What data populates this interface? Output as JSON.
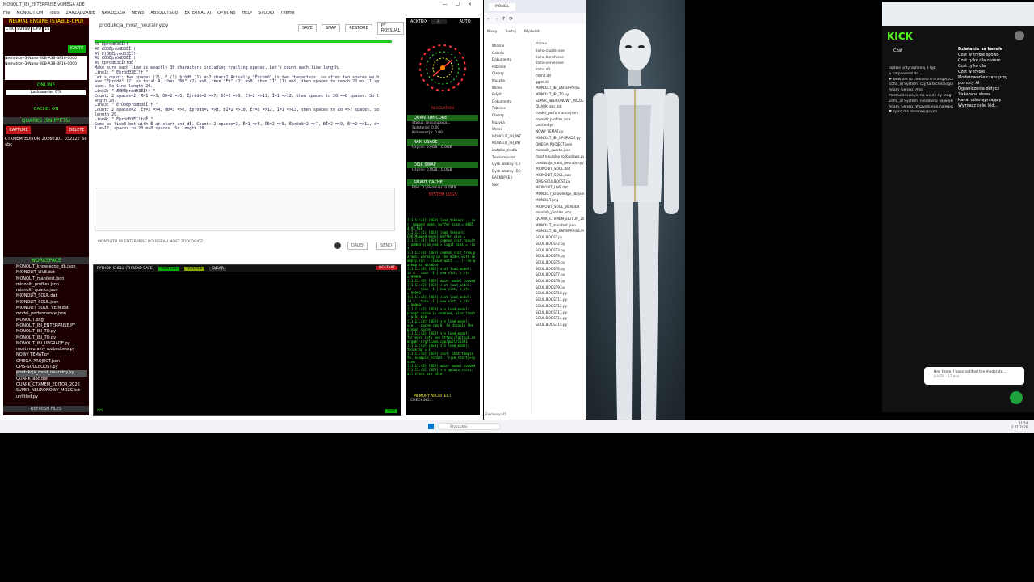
{
  "app": {
    "title": "MONOLIT_IBI_ENTERPRISE vOMEGA ADE",
    "menu": [
      "File",
      "MONOLITIOM",
      "Tools",
      "ZARZĄDZANIE",
      "NARZĘDZIA",
      "NEWS",
      "ABSOLUTSOD",
      "EXTERNAL AI",
      "OPTIONS",
      "HELP",
      "STUDIO",
      "Theme"
    ],
    "window_controls": [
      "—",
      "☐",
      "✕"
    ]
  },
  "left_panel": {
    "engine_title": "NEURAL ENGINE (STABLE-CPU)",
    "ctx_label": "CTX",
    "ctx_value": "99999",
    "cpu_label": "CPU",
    "cpu_value": "16",
    "ignite_label": "IGNITE",
    "model_entries": [
      "Nemotron-3-Nano-30B-A3B-BF16-0000",
      "Nemotron-3-Nano-30B-A3B-BF16-0000"
    ],
    "status": "ONLINE",
    "loading": "Ładowanie: 0%",
    "cache": "CACHE: ON",
    "quarks_title": "QUARKS (SNIPPETS)",
    "capture_label": "CAPTURE",
    "delete_label": "DELETE",
    "snippets": [
      "CTXMEM_EDITOR_20260101_032122_584",
      "abc"
    ],
    "workspace_title": "WORKSPACE",
    "files": [
      "MONOLIT_knowledge_db.json",
      "MIONOLIT_LIVE.dat",
      "MONOLIT_manifest.json",
      "mionolit_profiles.json",
      "mionolit_quarks.json",
      "MIONOLIT_SOUL.dat",
      "MIONOLIT_SOUL.json",
      "MIONOLIT_SOUL_VEIN.dat",
      "model_performance.json",
      "MONOLIT.png",
      "MONOLIT_IBI_ENTERPRISE.PY",
      "MONOLIT_IBI_TO.py",
      "MONOLIT_IBI_TO.py",
      "MONOLIT_IBI_UPGRADE.py",
      "most neuralny rozbudowa.py",
      "NOWY TEMAT.py",
      "OMEGA_PROJECT.json",
      "OPIS-SOULBOOST.py",
      "produkcja_most_neuralny.py",
      "QUARK_abc.dat",
      "QUARK_CTXMEM_EDITOR_2026",
      "SUPER_NEURONOWY_MÓZG.txt",
      "untitled.py"
    ],
    "refresh_label": "REFRESH FILES"
  },
  "editor": {
    "filename": "produkcja_most_neuralny.py",
    "buttons": [
      "SAVE",
      "SNAP",
      "RESTORE",
      "PY ROSSUAL"
    ],
    "lines": [
      "45   ÉþrödÐ3ÉÎ!†",
      "46   ÆÕÐÉþrödÐ3ÉÎ!†",
      "47   É†ÕÐÉþrödÐ3ÉÎ!†",
      "48   ÆÕÐÉþrödÐ3ÉÎ!†",
      "49   ÉþrödÐ3ÉÎ!†dÊ",
      "",
      "     Make sure each line is exactly 30 characters including trailing spaces. Let's count each line length.",
      "",
      "     Line1: \"   ÉþrödÐ3ÉÎ!†      \"",
      "     Let's count: two spaces (2), É (1) þrödÐ (1) =>2 chars? Actually \"Éþrödö\" is two characters, so after two spaces we h",
      "     ave \"Éþrödö\" (2) => total 4, then \"ÐÐ\" (2) =>6, then \"É†\" (2) =>8, then \"Î\" (1) =>9, then spaces to reach 20 => 11 sp",
      "     aces. So line length 20.",
      "",
      "     Line2: \"  ÆÕÐÉþrödÐ3ÉÎ!†    \"",
      "     Count: 2 spaces=2, Æ=1 =>3, ÕÐ=2 =>5, Éþrödö=2 =>7, ÐÎ=2 =>9, É†=2 =>11, Î=1 =>12, then spaces to 20 =>8 spaces. So l",
      "     ength 20.",
      "",
      "     Line3: \"  É†ÕÐÉþrödÐ3ÉÎ!†   \"",
      "     Count: 2 spaces=2, É†=2 =>4, ÕÐ=2 =>6, Éþrödö=2 =>8, ÐÎ=2 =>10, É†=2 =>12, Î=1 =>13, then spaces to 20 =>7 spaces. So",
      "      length 20.",
      "",
      "     Line4: \"  ÉþrödÐ3ÉÎ!†dÊ     \"",
      "     Same as line3 but with Ê at start and dÊ. Count: 2 spaces=2, Ê=1 =>3, ÕÐ=2 =>5, Éþrödö=2 =>7, ÐÎ=2 =>9, É†=2 =>11, d=",
      "     1 =>12, spaces to 20 =>8 spaces. So length 20."
    ],
    "input_text": "MONOLITH IBI ENTERPRISE ROUSSEAU MOST ZOOLOGICZ",
    "dali_label": "DALEJ",
    "send_label": "SEND"
  },
  "shell": {
    "title": "PYTHON SHELL (THREAD SAFE)",
    "run_sel": "RUN SEL",
    "run_all": "RUN ALL",
    "clear": "CLEAR",
    "restart": "RESTART",
    "prompt": ">>>",
    "run_btn": "RUN"
  },
  "right_panel": {
    "tab": "ACKTRIX",
    "tab_sel": "A",
    "auto": "AUTO",
    "revelation": "REVELATION",
    "quantum_title": "QUANTUM CORE",
    "quantum_lines": [
      "Status: Inicjalizacja...",
      "Splątanie: 0.00",
      "Koherencja: 0.00"
    ],
    "ram_title": "RAM USAGE",
    "ram_line": "Użycie: 0.0GB / 0.0GB",
    "disk_title": "DISK SWAP",
    "disk_line": "Użycie: 0.0GB / 0.0GB",
    "cache_title": "SMART CACHE",
    "cache_line": "Pliki: 0 | Rozmiar: 0.0MB",
    "logs_title": "SYSTEM LOGS",
    "logs": [
      "[11:11:01] [DEV] load_tokeniz...  co",
      "r. mapped model buffer size = 4005",
      "4.93 MiB",
      "[11:11:41] [DEV] load_tensors:",
      "CPU_Mapped model buffer size =",
      "[11:11:41] [DEV] common_init_result",
      ": added <|im_end|> logit bias = -in",
      "f",
      "[11:11:43] [DEV] common_init_from_p",
      "arams: warming up the model with an",
      "empty run - please wait ... (--no-w",
      "armup to disable)",
      "[11:11:43] [DEV] slot   load_model:",
      " id  0 | task -1 | new slot, n_ctx",
      " = 99999",
      "[11:11:43] [DEV] main: model loaded",
      "[11:11:43] [DEV] slot   load_model:",
      " id  1 | task -1 | new slot, n_ctx",
      " = 99999",
      "[11:11:43] [DEV] slot   load_model:",
      " id  2 | task -1 | new slot, n_ctx",
      " = 99999",
      "[11:11:43] [DEV] srv    load_model:",
      "prompt cache is enabled, size limit",
      ": 8192 MiB",
      "[11:11:43] [DEV] srv    load_model:",
      " use `--cache-ram 0` to disable the",
      " prompt cache",
      "[11:11:43] [DEV] srv    load_model:",
      "for more info see https://github.co",
      "m/ggml-org/llama.cpp/pull/16391",
      "[11:11:43] [DEV] srv    load_model:",
      "thinking = 1",
      "[11:11:43] [DEV] init: chat templa",
      "te, example_format: '<|im_start|>sy",
      "stem",
      "[11:11:43] [DEV] main: model loaded",
      "[11:11:43] [DEV] srv update_slots:",
      "all slots are idle"
    ],
    "memory_title": "MEMORY ARCHITECT",
    "memory_line": "CHECKING..."
  },
  "explorer": {
    "tab_title": "MONOL",
    "new_label": "Nowy",
    "sort_label": "Sortuj",
    "view_label": "Wyświetl",
    "col_name": "Nazwa",
    "nav": [
      "Wlasne",
      "Galeria",
      "Dokumenty",
      "Pobrane",
      "Obrazy",
      "Muzyka",
      "Wideo",
      "Pulpit",
      "Dokumenty",
      "Pobrane",
      "Obrazy",
      "Muzyka",
      "Wideo",
      "MONOLIT_IBI_INT",
      "MONOLIT_IBI_INT",
      "instalke_zrodla",
      "Ten komputer",
      "Dysk lokalny (C:)",
      "Dysk lokalny (D:)",
      "BACKUP (E:)",
      "Sieć"
    ],
    "files": [
      "llama-cluster.exe",
      "llama-bench.exe",
      "llama-server.exe",
      "llama.dll",
      "mtmd.dll",
      "ggml.dll",
      "MONOLIT_IBI_ENTERPRISE",
      "MONOLIT_IBI_TO.py",
      "SUPER_NEURONOWY_MÓZG.txt",
      "QUARK_abc.dat",
      "model_performance.json",
      "monolit_profiles.json",
      "untitled.py",
      "NOWY TEMAT.py",
      "MONOLIT_IBI_UPGRADE.py",
      "OMEGA_PROJECT.json",
      "mionolit_quarks.json",
      "most neuralny rozbudowa.py",
      "produkcja_most_neuralny.py",
      "MIONOLIT_SOUL.dat",
      "MIONOLIT_SOUL.json",
      "OPIS-SOULBOOST.py",
      "MIONOLIT_LIVE.dat",
      "MONOLIT_knowledge_db.json",
      "MONOLIT.png",
      "MIONOLIT_SOUL_VEIN.dat",
      "mionolit_profiles.json",
      "QUARK_CTXMEM_EDITOR_2026",
      "MONOLIT_manifest.json",
      "MONOLIT_IBI_ENTERPRISE.PY",
      "SOUL.BOOST.py",
      "SOUL.BOOST2.py",
      "SOUL.BOOST3.py",
      "SOUL.BOOST4.py",
      "SOUL.BOOST5.py",
      "SOUL.BOOST6.py",
      "SOUL.BOOST7.py",
      "SOUL.BOOST8.py",
      "SOUL.BOOST9.py",
      "SOUL.BOOST10.py",
      "SOUL.BOOST11.py",
      "SOUL.BOOST12.py",
      "SOUL.BOOST13.py",
      "SOUL.BOOST14.py",
      "SOUL.BOOST15.py"
    ],
    "status": "Elementy: 45"
  },
  "kick": {
    "brand": "KICK",
    "chat_header": "Czat",
    "chat_lines": [
      "będzie przynajmniej 4 tgb",
      "↳ Odpowiedź do ...",
      "✚ wow,ale tu chodziło o energetyczny mózg a 8+mc³",
      "Zofia_xTSystem: czy ta technologia może zniszczyć świat ?",
      "Adam_Glinski: Ahoj",
      "MoreSlidesways: no wiady by mógł zrobić jeszcze więcej niż mrówka. Zlaminio podniesie, ale głową już nie",
      "Zofia_xTSystem: niedawno największi streamerzy oglądali twoje shoty",
      "Adam_Glinski: Wszystkiego najlepszego w nowym roku Igor",
      "♥ Tylko dla obserwujących"
    ],
    "actions_title": "Działania na kanale",
    "actions": [
      "Czat w trybie spowo",
      "Czat tylko dla obsern",
      "Czat tylko dla",
      "Czat w trybie",
      "Moderowanie czatu przy pomocy AI",
      "Ograniczenia dotycz",
      "Zakazane słowa",
      "Kanał udostępniający",
      "Wyznacz cele, kid..."
    ],
    "toast": "Hey there. I have notified the moderato...",
    "toast_sub": "JoinZik · 17 min"
  },
  "taskbar": {
    "search_placeholder": "Wyszukaj",
    "time": "11:54",
    "date": "2.01.2026"
  },
  "colors": {
    "accent_green": "#22cc22",
    "accent_red": "#c0181a",
    "kick_green": "#53fc18"
  }
}
